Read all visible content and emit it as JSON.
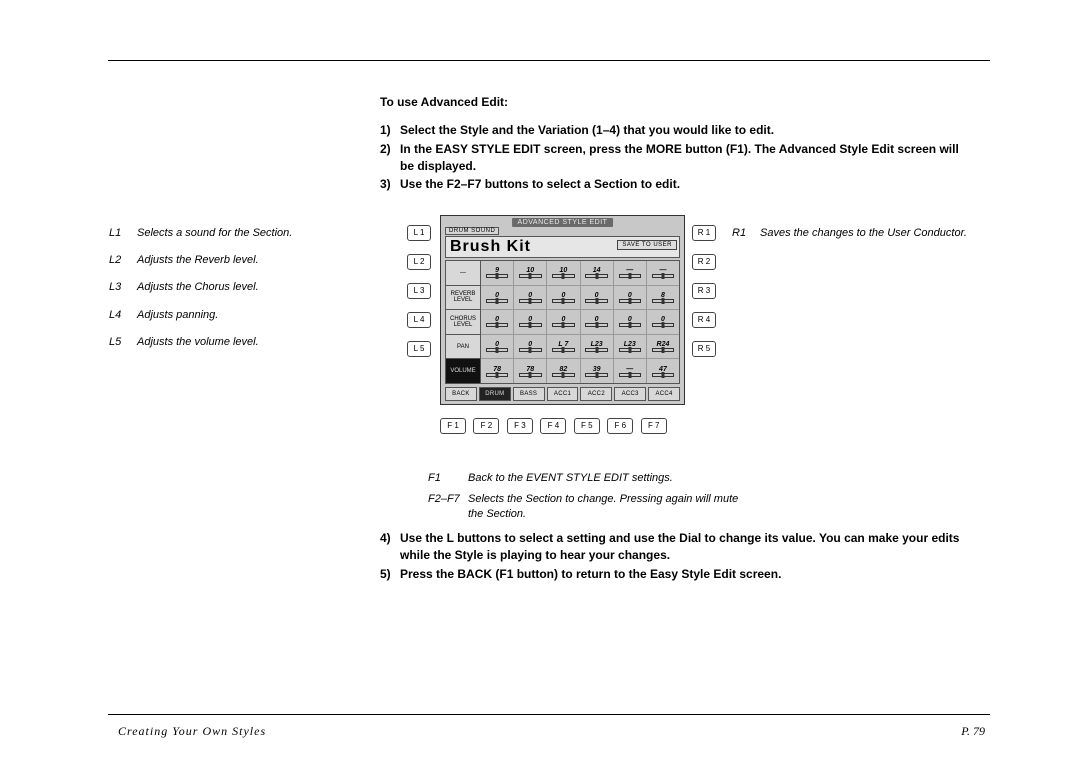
{
  "footer": {
    "section": "Creating Your Own Styles",
    "page": "P. 79"
  },
  "heading": "To use Advanced Edit:",
  "steps_top": [
    {
      "n": "1)",
      "t": "Select the Style and the Variation (1–4) that you would like to edit."
    },
    {
      "n": "2)",
      "t": "In the EASY STYLE EDIT screen,  press the MORE button (F1).   The Advanced Style Edit screen will be displayed."
    },
    {
      "n": "3)",
      "t": "Use the F2–F7 buttons to select a Section to edit."
    }
  ],
  "left_legend": [
    {
      "k": "L1",
      "t": "Selects a sound for the Section."
    },
    {
      "k": "L2",
      "t": "Adjusts the Reverb level."
    },
    {
      "k": "L3",
      "t": "Adjusts the Chorus level."
    },
    {
      "k": "L4",
      "t": "Adjusts panning."
    },
    {
      "k": "L5",
      "t": "Adjusts the volume level."
    }
  ],
  "right_legend": [
    {
      "k": "R1",
      "t": "Saves the changes to the User Conductor."
    }
  ],
  "f_legend": [
    {
      "k": "F1",
      "t": "Back to the EVENT STYLE EDIT settings."
    },
    {
      "k": "F2–F7",
      "t": "Selects the Section to change.  Pressing again will mute the Section."
    }
  ],
  "steps_bottom": [
    {
      "n": "4)",
      "t": "Use the L buttons to select a setting and use the Dial to change its value.   You can make your edits while the Style is playing to hear your changes."
    },
    {
      "n": "5)",
      "t": "Press the BACK (F1 button) to return to the Easy Style Edit screen."
    }
  ],
  "keys": {
    "L": [
      "L 1",
      "L 2",
      "L 3",
      "L 4",
      "L 5"
    ],
    "R": [
      "R 1",
      "R 2",
      "R 3",
      "R 4",
      "R 5"
    ],
    "F": [
      "F 1",
      "F 2",
      "F 3",
      "F 4",
      "F 5",
      "F 6",
      "F 7"
    ]
  },
  "lcd": {
    "title": "ADVANCED STYLE EDIT",
    "sub": "DRUM SOUND",
    "kit": "Brush Kit",
    "save": "SAVE TO USER",
    "params": [
      "—",
      "REVERB LEVEL",
      "CHORUS LEVEL",
      "PAN",
      "VOLUME"
    ],
    "param_dark_index": 4,
    "columns": [
      {
        "vals": [
          "9",
          "0",
          "0",
          "0",
          "78"
        ]
      },
      {
        "vals": [
          "10",
          "0",
          "0",
          "0",
          "78"
        ]
      },
      {
        "vals": [
          "10",
          "0",
          "0",
          "L 7",
          "82"
        ]
      },
      {
        "vals": [
          "14",
          "0",
          "0",
          "L23",
          "39"
        ]
      },
      {
        "vals": [
          "—",
          "0",
          "0",
          "L23",
          "—"
        ]
      },
      {
        "vals": [
          "—",
          "8",
          "0",
          "R24",
          "47"
        ]
      }
    ],
    "tabs": [
      "BACK",
      "DRUM",
      "BASS",
      "ACC1",
      "ACC2",
      "ACC3",
      "ACC4"
    ],
    "tab_dark_index": 1
  }
}
